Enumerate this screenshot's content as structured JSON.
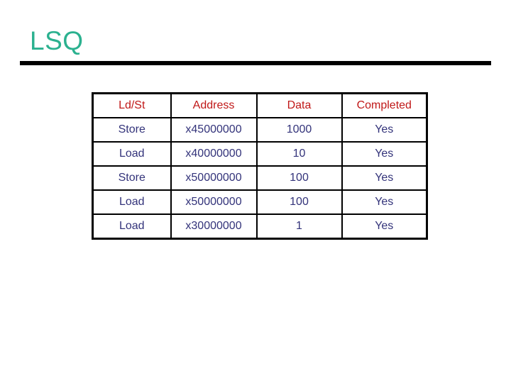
{
  "slide": {
    "title": "LSQ",
    "title_color": "#2bb18f",
    "rule_color": "#000000",
    "background_color": "#ffffff"
  },
  "table": {
    "name": "load-store-queue-table",
    "header_color": "#c01818",
    "body_color": "#33337a",
    "border_color": "#000000",
    "columns": [
      "Ld/St",
      "Address",
      "Data",
      "Completed"
    ],
    "rows": [
      {
        "ldst": "Store",
        "address": "x45000000",
        "data": "1000",
        "completed": "Yes"
      },
      {
        "ldst": "Load",
        "address": "x40000000",
        "data": "10",
        "completed": "Yes"
      },
      {
        "ldst": "Store",
        "address": "x50000000",
        "data": "100",
        "completed": "Yes"
      },
      {
        "ldst": "Load",
        "address": "x50000000",
        "data": "100",
        "completed": "Yes"
      },
      {
        "ldst": "Load",
        "address": "x30000000",
        "data": "1",
        "completed": "Yes"
      }
    ]
  }
}
